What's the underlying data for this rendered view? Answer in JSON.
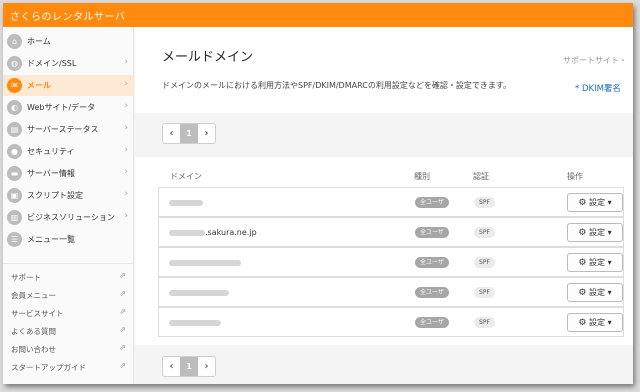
{
  "app": {
    "brand": "さくらのレンタルサーバ"
  },
  "sidebar": {
    "items": [
      {
        "label": "ホーム",
        "icon": "home-icon",
        "glyph": "⌂",
        "chevron": ""
      },
      {
        "label": "ドメイン/SSL",
        "icon": "globe-icon",
        "glyph": "◍",
        "chevron": "›"
      },
      {
        "label": "メール",
        "icon": "mail-icon",
        "glyph": "✉",
        "chevron": "›"
      },
      {
        "label": "Webサイト/データ",
        "icon": "web-icon",
        "glyph": "◐",
        "chevron": "›"
      },
      {
        "label": "サーバーステータス",
        "icon": "status-icon",
        "glyph": "▤",
        "chevron": "›"
      },
      {
        "label": "セキュリティ",
        "icon": "lock-icon",
        "glyph": "●",
        "chevron": "›"
      },
      {
        "label": "サーバー情報",
        "icon": "server-icon",
        "glyph": "▬",
        "chevron": "›"
      },
      {
        "label": "スクリプト設定",
        "icon": "script-icon",
        "glyph": "▣",
        "chevron": "›"
      },
      {
        "label": "ビジネスソリューション",
        "icon": "business-icon",
        "glyph": "▥",
        "chevron": "›"
      },
      {
        "label": "メニュー一覧",
        "icon": "list-icon",
        "glyph": "☰",
        "chevron": ""
      }
    ],
    "links": [
      {
        "label": "サポート"
      },
      {
        "label": "会員メニュー"
      },
      {
        "label": "サービスサイト"
      },
      {
        "label": "よくある質問"
      },
      {
        "label": "お問い合わせ"
      },
      {
        "label": "スタートアップガイド"
      }
    ],
    "external_glyph": "⇗"
  },
  "main": {
    "title": "メールドメイン",
    "support_link": "サポートサイト・",
    "description": "ドメインのメールにおける利用方法やSPF/DKIM/DMARCの利用設定などを確認・設定できます。",
    "dkim_link": "* DKIM署名",
    "pagination": {
      "prev": "‹",
      "page": "1",
      "next": "›"
    },
    "table": {
      "headers": {
        "domain": "ドメイン",
        "type": "種別",
        "auth": "認証",
        "action": "操作"
      },
      "rows": [
        {
          "domain": "",
          "type": "全ユーザ",
          "auth": "SPF",
          "action": "設定"
        },
        {
          "domain": ".sakura.ne.jp",
          "type": "全ユーザ",
          "auth": "SPF",
          "action": "設定"
        },
        {
          "domain": "",
          "type": "全ユーザ",
          "auth": "SPF",
          "action": "設定"
        },
        {
          "domain": "",
          "type": "全ユーザ",
          "auth": "SPF",
          "action": "設定"
        },
        {
          "domain": "",
          "type": "全ユーザ",
          "auth": "SPF",
          "action": "設定"
        }
      ]
    }
  },
  "colors": {
    "brand": "#ff8a0d",
    "active_bg": "#fde9d4",
    "link": "#1a73c8"
  }
}
